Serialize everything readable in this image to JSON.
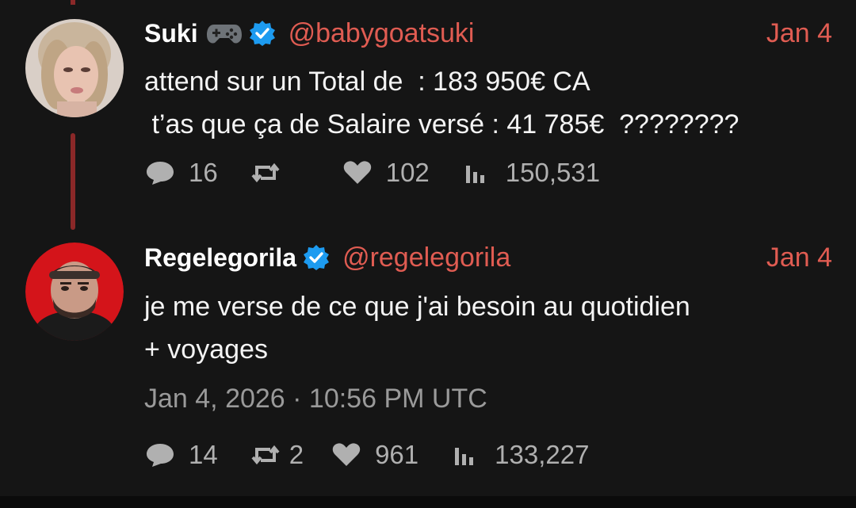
{
  "tweets": [
    {
      "name": "Suki",
      "emoji_icon": "game-controller-icon",
      "verified": true,
      "handle": "@babygoatsuki",
      "date": "Jan 4",
      "lines": [
        "attend sur un Total de  : 183 950€ CA",
        " t’as que ça de Salaire versé : 41 785€  ????????"
      ],
      "stats": {
        "replies": "16",
        "retweets": "",
        "likes": "102",
        "views": "150,531"
      }
    },
    {
      "name": "Regelegorila",
      "verified": true,
      "handle": "@regelegorila",
      "date": "Jan 4",
      "lines": [
        "je me verse de ce que j'ai besoin au quotidien",
        "+ voyages"
      ],
      "timestamp": "Jan 4, 2026 · 10:56 PM UTC",
      "stats": {
        "replies": "14",
        "retweets": "2",
        "likes": "961",
        "views": "133,227"
      }
    }
  ],
  "colors": {
    "background": "#151515",
    "accent": "#e05c52",
    "verified": "#1d9bf0",
    "thread_line": "#8a2828",
    "muted": "#b0b0b0"
  }
}
